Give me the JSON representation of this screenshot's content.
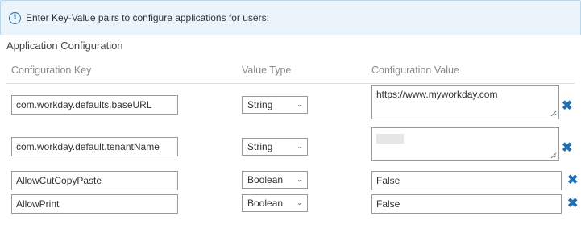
{
  "banner": {
    "icon": "info-icon",
    "text": "Enter Key-Value pairs to configure applications for users:"
  },
  "section_title": "Application Configuration",
  "columns": {
    "key": "Configuration Key",
    "type": "Value Type",
    "value": "Configuration Value"
  },
  "rows": [
    {
      "key": "com.workday.defaults.baseURL",
      "type": "String",
      "value": "https://www.myworkday.com",
      "remove_icon": "close-icon"
    },
    {
      "key": "com.workday.default.tenantName",
      "type": "String",
      "value": "",
      "remove_icon": "close-icon"
    },
    {
      "key": "AllowCutCopyPaste",
      "type": "Boolean",
      "value": "False",
      "remove_icon": "close-icon"
    },
    {
      "key": "AllowPrint",
      "type": "Boolean",
      "value": "False",
      "remove_icon": "close-icon"
    }
  ],
  "colors": {
    "banner_bg": "#eaf4fa",
    "banner_border": "#b9d7ea",
    "remove_icon": "#1f6fb5"
  }
}
